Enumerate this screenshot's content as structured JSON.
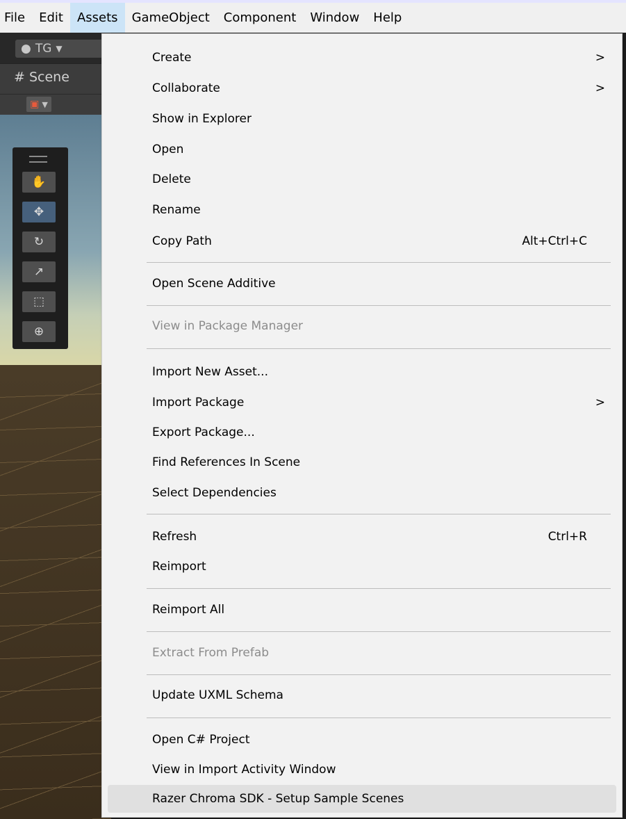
{
  "menubar": {
    "items": [
      "File",
      "Edit",
      "Assets",
      "GameObject",
      "Component",
      "Window",
      "Help"
    ],
    "active": "Assets"
  },
  "editor": {
    "account_label": "TG",
    "scene_tab_label": "Scene",
    "scene_tab_icon": "#"
  },
  "menu": {
    "items": [
      {
        "label": "Create",
        "submenu": true
      },
      {
        "label": "Collaborate",
        "submenu": true
      },
      {
        "label": "Show in Explorer"
      },
      {
        "label": "Open"
      },
      {
        "label": "Delete"
      },
      {
        "label": "Rename"
      },
      {
        "label": "Copy Path",
        "shortcut": "Alt+Ctrl+C"
      },
      {
        "label": "Open Scene Additive"
      },
      {
        "label": "View in Package Manager",
        "disabled": true
      },
      {
        "label": "Import New Asset..."
      },
      {
        "label": "Import Package",
        "submenu": true
      },
      {
        "label": "Export Package..."
      },
      {
        "label": "Find References In Scene"
      },
      {
        "label": "Select Dependencies"
      },
      {
        "label": "Refresh",
        "shortcut": "Ctrl+R"
      },
      {
        "label": "Reimport"
      },
      {
        "label": "Reimport All"
      },
      {
        "label": "Extract From Prefab",
        "disabled": true
      },
      {
        "label": "Update UXML Schema"
      },
      {
        "label": "Open C# Project"
      },
      {
        "label": "View in Import Activity Window"
      },
      {
        "label": "Razer Chroma SDK - Setup Sample Scenes",
        "highlighted": true
      }
    ],
    "submenu_glyph": ">"
  },
  "colors": {
    "menu_bg": "#f2f2f2",
    "menubar_active": "#cce4f7",
    "disabled_text": "#8c8c8c",
    "highlight_bg": "#e0e0e0"
  }
}
